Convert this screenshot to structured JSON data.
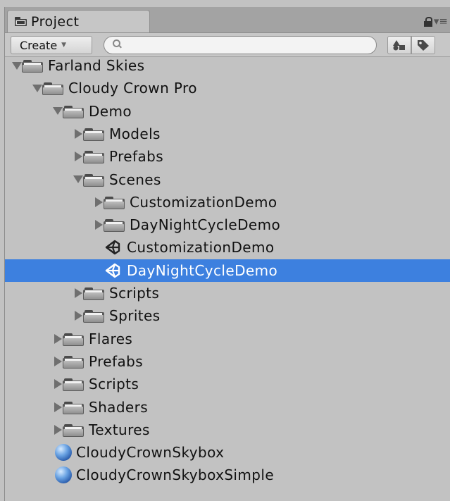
{
  "tab": {
    "title": "Project"
  },
  "toolbar": {
    "create_label": "Create",
    "search_value": ""
  },
  "tree": [
    {
      "label": "Farland Skies",
      "depth": 0,
      "toggle": "down",
      "kind": "folder"
    },
    {
      "label": "Cloudy Crown Pro",
      "depth": 1,
      "toggle": "down",
      "kind": "folder"
    },
    {
      "label": "Demo",
      "depth": 2,
      "toggle": "down",
      "kind": "folder"
    },
    {
      "label": "Models",
      "depth": 3,
      "toggle": "right",
      "kind": "folder"
    },
    {
      "label": "Prefabs",
      "depth": 3,
      "toggle": "right",
      "kind": "folder"
    },
    {
      "label": "Scenes",
      "depth": 3,
      "toggle": "down",
      "kind": "folder"
    },
    {
      "label": "CustomizationDemo",
      "depth": 4,
      "toggle": "right",
      "kind": "folder"
    },
    {
      "label": "DayNightCycleDemo",
      "depth": 4,
      "toggle": "right",
      "kind": "folder"
    },
    {
      "label": "CustomizationDemo",
      "depth": 4,
      "toggle": "none",
      "kind": "scene"
    },
    {
      "label": "DayNightCycleDemo",
      "depth": 4,
      "toggle": "none",
      "kind": "scene",
      "selected": true
    },
    {
      "label": "Scripts",
      "depth": 3,
      "toggle": "right",
      "kind": "folder"
    },
    {
      "label": "Sprites",
      "depth": 3,
      "toggle": "right",
      "kind": "folder"
    },
    {
      "label": "Flares",
      "depth": 2,
      "toggle": "right",
      "kind": "folder"
    },
    {
      "label": "Prefabs",
      "depth": 2,
      "toggle": "right",
      "kind": "folder"
    },
    {
      "label": "Scripts",
      "depth": 2,
      "toggle": "right",
      "kind": "folder"
    },
    {
      "label": "Shaders",
      "depth": 2,
      "toggle": "right",
      "kind": "folder"
    },
    {
      "label": "Textures",
      "depth": 2,
      "toggle": "right",
      "kind": "folder"
    },
    {
      "label": "CloudyCrownSkybox",
      "depth": 2,
      "toggle": "none",
      "kind": "material"
    },
    {
      "label": "CloudyCrownSkyboxSimple",
      "depth": 2,
      "toggle": "none",
      "kind": "material"
    }
  ]
}
